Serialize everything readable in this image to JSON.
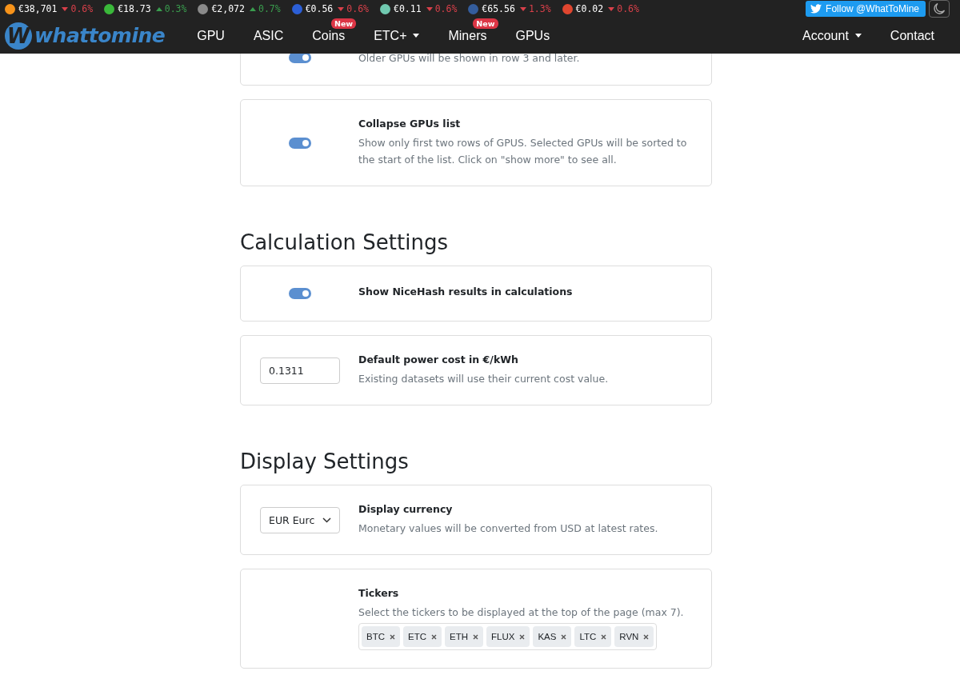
{
  "tickers": [
    {
      "price": "€38,701",
      "rising": false,
      "change": "0.6%",
      "color": "#f7931a"
    },
    {
      "price": "€18.73",
      "rising": true,
      "change": "0.3%",
      "color": "#3ab83a"
    },
    {
      "price": "€2,072",
      "rising": true,
      "change": "0.7%",
      "color": "#8a8a8a"
    },
    {
      "price": "€0.56",
      "rising": false,
      "change": "0.6%",
      "color": "#2c5fd6"
    },
    {
      "price": "€0.11",
      "rising": false,
      "change": "0.6%",
      "color": "#70c9b0"
    },
    {
      "price": "€65.56",
      "rising": false,
      "change": "1.3%",
      "color": "#345d9d"
    },
    {
      "price": "€0.02",
      "rising": false,
      "change": "0.6%",
      "color": "#e0462f"
    }
  ],
  "follow_button": "Follow @WhatToMine",
  "logo": {
    "mark": "W",
    "text": "whattomine"
  },
  "nav_items": [
    {
      "label": "GPU",
      "dropdown": false
    },
    {
      "label": "ASIC",
      "dropdown": false
    },
    {
      "label": "Coins",
      "dropdown": false,
      "badge": "New"
    },
    {
      "label": "ETC+",
      "dropdown": true
    },
    {
      "label": "Miners",
      "dropdown": false,
      "badge": "New"
    },
    {
      "label": "GPUs",
      "dropdown": false
    }
  ],
  "nav_right": [
    {
      "label": "Account",
      "dropdown": true
    },
    {
      "label": "Contact",
      "dropdown": false
    }
  ],
  "blocks": [
    {
      "kind": "card",
      "control": {
        "kind": "toggle",
        "on": true
      },
      "description": "Older GPUs will be shown in row 3 and later."
    },
    {
      "kind": "card",
      "control": {
        "kind": "toggle",
        "on": true
      },
      "title": "Collapse GPUs list",
      "description": "Show only first two rows of GPUS. Selected GPUs will be sorted to the start of the list. Click on \"show more\" to see all."
    },
    {
      "kind": "heading",
      "text": "Calculation Settings"
    },
    {
      "kind": "card",
      "control": {
        "kind": "toggle",
        "on": true
      },
      "title": "Show NiceHash results in calculations"
    },
    {
      "kind": "card",
      "control": {
        "kind": "number",
        "value": "0.1311"
      },
      "title": "Default power cost in €/kWh",
      "description": "Existing datasets will use their current cost value."
    },
    {
      "kind": "heading",
      "text": "Display Settings"
    },
    {
      "kind": "card",
      "control": {
        "kind": "select",
        "value": "EUR Eurc"
      },
      "title": "Display currency",
      "description": "Monetary values will be converted from USD at latest rates."
    },
    {
      "kind": "card",
      "control": {
        "kind": "tags",
        "tags": [
          "BTC",
          "ETC",
          "ETH",
          "FLUX",
          "KAS",
          "LTC",
          "RVN"
        ]
      },
      "title": "Tickers",
      "description": "Select the tickers to be displayed at the top of the page (max 7)."
    }
  ]
}
